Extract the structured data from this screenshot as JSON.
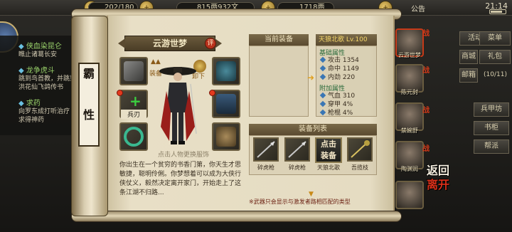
{
  "topbar": {
    "stamina": "202/180",
    "silver": "815两932文",
    "gold": "1718两",
    "notice": "公告",
    "time": "21:14"
  },
  "quests": [
    {
      "title": "侠血染昆仑",
      "desc": "瞧止诸葛长安"
    },
    {
      "title": "龙争虎斗",
      "desc": "跳到鸟首教，并跳到",
      "desc2": "洪花仙飞鸽传书"
    },
    {
      "title": "求药",
      "desc": "向罗东成打听治疗",
      "desc2": "求得神药"
    }
  ],
  "right_menu": [
    "活动",
    "菜单",
    "商城",
    "礼包",
    "邮箱",
    "兵甲坊",
    "书柜",
    "帮派"
  ],
  "right_menu_extra": "(10/11)",
  "scroll_label": [
    "霸",
    "性"
  ],
  "character": {
    "name": "云游世梦",
    "eval": "评",
    "hint": "点击人物更换服饰",
    "desc": "你出生在一个贫穷的书香门第，你天生才思敏捷，聪明伶俐。你梦想着可以成为大侠行侠仗义，毅然决定离开家门，开始走上了这条江湖不归路..."
  },
  "slots": {
    "weapon_label": "兵刃",
    "arrow_left": "装备",
    "arrow_right": "卸下"
  },
  "current_equip": {
    "title": "当前装备"
  },
  "stats": {
    "item_title": "天狼北歌 Lv.100",
    "basic_header": "基础属性",
    "basic": [
      {
        "name": "攻击",
        "value": "1354"
      },
      {
        "name": "命中",
        "value": "1149"
      },
      {
        "name": "内劲",
        "value": "220"
      }
    ],
    "extra_header": "附加属性",
    "extra": [
      {
        "name": "气血",
        "value": "310"
      },
      {
        "name": "穿甲",
        "value": "4%"
      },
      {
        "name": "枪棍",
        "value": "4%"
      }
    ]
  },
  "equip_list": {
    "title": "装备列表",
    "items": [
      {
        "name": "碎虎枪"
      },
      {
        "name": "碎虎枪"
      },
      {
        "name": "天狼北歌"
      },
      {
        "name": "吾揽枝"
      }
    ],
    "equip_button": [
      "点击",
      "装备"
    ],
    "footnote": "※武器只会显示与激发者路相匹配的类型"
  },
  "roster": [
    {
      "name": "云游世梦",
      "selected": true
    },
    {
      "name": "陈元封",
      "selected": false
    },
    {
      "name": "禁婉舒",
      "selected": false
    },
    {
      "name": "陶渊润",
      "selected": false
    },
    {
      "name": "",
      "selected": false
    }
  ],
  "back_button": [
    "返回",
    "离开"
  ],
  "colors": {
    "accent": "#c63a18",
    "paper": "#e5dcc2",
    "gold": "#f6d86a"
  }
}
